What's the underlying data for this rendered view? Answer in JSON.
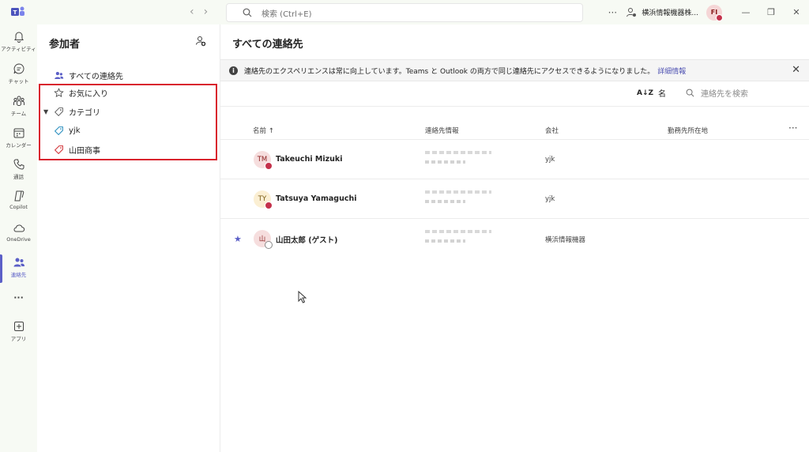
{
  "titlebar": {
    "search_placeholder": "検索 (Ctrl+E)",
    "more_label": "···",
    "org_name": "横浜情報機器株...",
    "user_initials": "FI",
    "nav_back": "‹",
    "nav_forward": "›",
    "minimize": "—",
    "restore": "❐",
    "close": "✕"
  },
  "rail": {
    "items": [
      {
        "label": "アクティビティ",
        "icon": "bell-icon"
      },
      {
        "label": "チャット",
        "icon": "chat-icon"
      },
      {
        "label": "チーム",
        "icon": "teams-icon"
      },
      {
        "label": "カレンダー",
        "icon": "calendar-icon"
      },
      {
        "label": "通話",
        "icon": "phone-icon"
      },
      {
        "label": "Copilot",
        "icon": "copilot-icon"
      },
      {
        "label": "OneDrive",
        "icon": "cloud-icon"
      },
      {
        "label": "連絡先",
        "icon": "people-icon"
      },
      {
        "label": "···",
        "icon": "more-icon"
      },
      {
        "label": "アプリ",
        "icon": "apps-icon"
      }
    ]
  },
  "left_panel": {
    "title": "参加者",
    "items": [
      {
        "label": "すべての連絡先",
        "icon": "people-icon"
      },
      {
        "label": "お気に入り",
        "icon": "star-icon"
      },
      {
        "label": "カテゴリ",
        "icon": "tag-icon"
      },
      {
        "label": "yjk",
        "icon": "tag-blue-icon"
      },
      {
        "label": "山田商事",
        "icon": "tag-red-icon"
      }
    ]
  },
  "main": {
    "title": "すべての連絡先",
    "banner_text": "連絡先のエクスペリエンスは常に向上しています。Teams と Outlook の両方で同じ連絡先にアクセスできるようになりました。",
    "banner_link": "詳細情報",
    "sort_label": "名",
    "sort_icon_text": "A↓Z",
    "filter_placeholder": "連絡先を検索",
    "columns": [
      "名前 ↑",
      "連絡先情報",
      "会社",
      "勤務先所在地"
    ],
    "more_columns": "···",
    "contacts": [
      {
        "initials": "TM",
        "name": "Takeuchi Mizuki",
        "company": "yjk",
        "favorite": false,
        "status": "busy",
        "avatar_bg": "#f6dede",
        "avatar_fg": "#8a1c1c"
      },
      {
        "initials": "TY",
        "name": "Tatsuya Yamaguchi",
        "company": "yjk",
        "favorite": false,
        "status": "dnd",
        "avatar_bg": "#fbefd3",
        "avatar_fg": "#7a5a12"
      },
      {
        "initials": "山",
        "name": "山田太郎 (ゲスト)",
        "company": "横浜情報機器",
        "favorite": true,
        "status": "offline",
        "avatar_bg": "#f6dede",
        "avatar_fg": "#8a1c1c"
      }
    ]
  },
  "colors": {
    "accent": "#5b5fc7",
    "highlight": "#d9232d",
    "busy": "#c4314b"
  }
}
